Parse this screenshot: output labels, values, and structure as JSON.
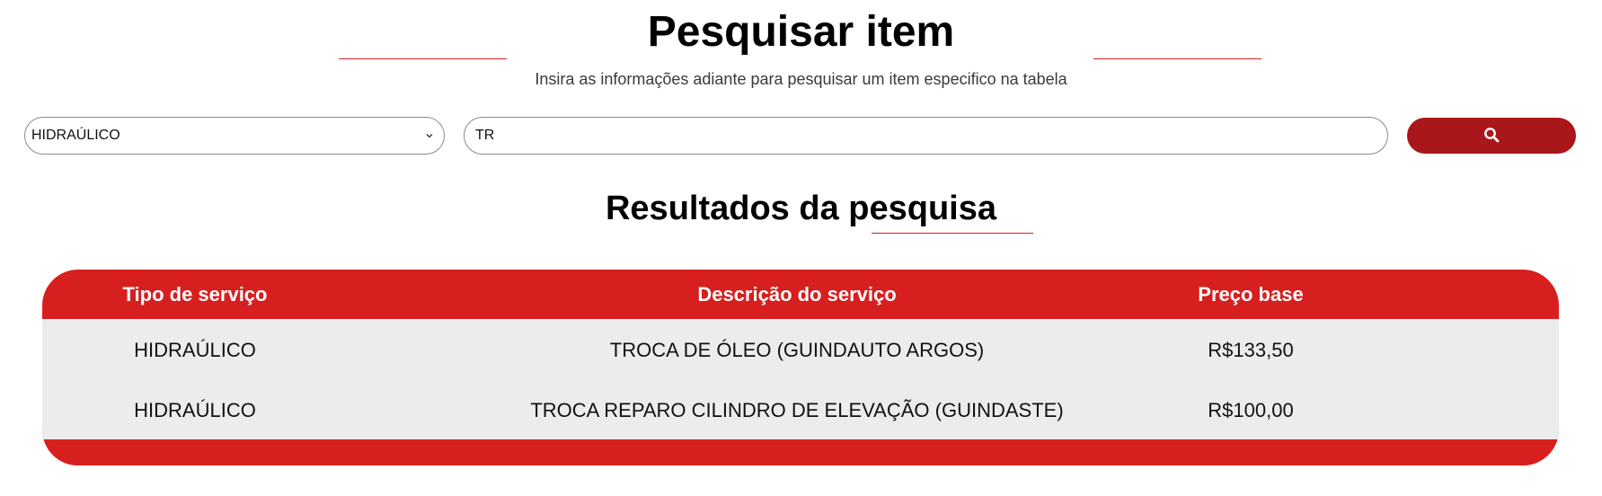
{
  "header": {
    "title": "Pesquisar item",
    "subtitle": "Insira as informações adiante para pesquisar um item especifico na tabela"
  },
  "search": {
    "category_value": "HIDRAÚLICO",
    "query_value": "TR",
    "button_icon": "search-icon"
  },
  "results": {
    "title": "Resultados da pesquisa",
    "columns": [
      "Tipo de serviço",
      "Descrição do serviço",
      "Preço base"
    ],
    "rows": [
      {
        "type": "HIDRAÚLICO",
        "description": "TROCA DE ÓLEO (GUINDAUTO ARGOS)",
        "price": "R$133,50"
      },
      {
        "type": "HIDRAÚLICO",
        "description": "TROCA REPARO CILINDRO DE ELEVAÇÃO (GUINDASTE)",
        "price": "R$100,00"
      }
    ]
  },
  "colors": {
    "accent_red": "#d71f1f",
    "button_red": "#a9171a",
    "row_background": "#ececec"
  }
}
